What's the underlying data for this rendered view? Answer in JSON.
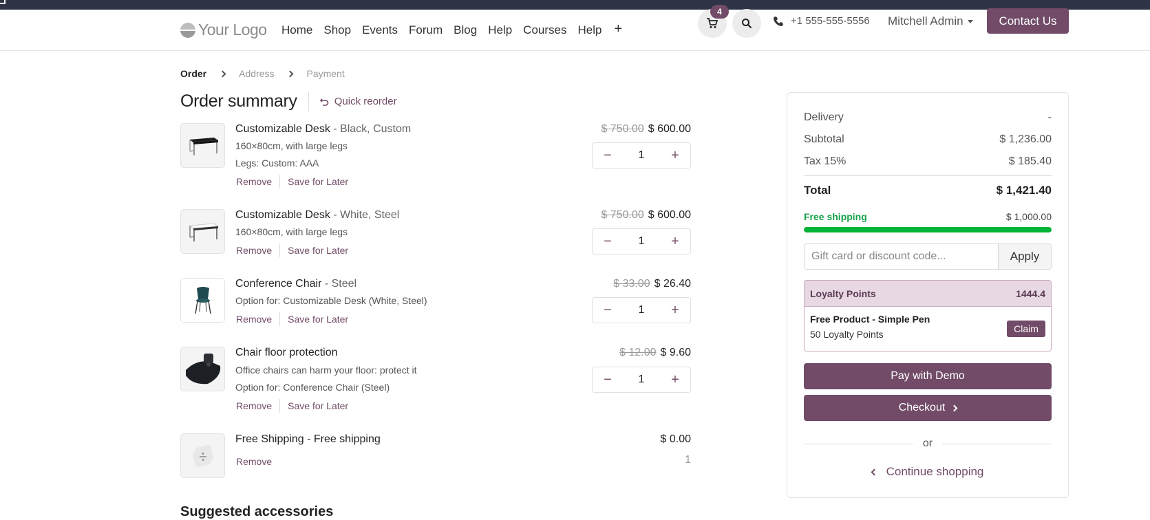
{
  "header": {
    "logo_text": "Your Logo",
    "nav": [
      "Home",
      "Shop",
      "Events",
      "Forum",
      "Blog",
      "Help",
      "Courses",
      "Help"
    ],
    "nav_plus": "+",
    "cart_count": "4",
    "phone": "+1 555-555-5556",
    "user_name": "Mitchell Admin",
    "contact_label": "Contact Us"
  },
  "steps": [
    "Order",
    "Address",
    "Payment"
  ],
  "order": {
    "title": "Order summary",
    "quick_reorder": "Quick reorder",
    "remove_label": "Remove",
    "save_label": "Save for Later",
    "lines": [
      {
        "name": "Customizable Desk",
        "variant": " - Black, Custom",
        "desc": [
          "160×80cm, with large legs",
          "Legs: Custom: AAA"
        ],
        "old_price": "$ 750.00",
        "price": "$ 600.00",
        "qty": "1"
      },
      {
        "name": "Customizable Desk",
        "variant": " - White, Steel",
        "desc": [
          "160×80cm, with large legs"
        ],
        "old_price": "$ 750.00",
        "price": "$ 600.00",
        "qty": "1"
      },
      {
        "name": "Conference Chair",
        "variant": " - Steel",
        "desc": [
          "Option for: Customizable Desk (White, Steel)"
        ],
        "old_price": "$ 33.00",
        "price": "$ 26.40",
        "qty": "1"
      },
      {
        "name": "Chair floor protection",
        "variant": "",
        "desc": [
          "Office chairs can harm your floor: protect it",
          "Option for: Conference Chair (Steel)"
        ],
        "old_price": "$ 12.00",
        "price": "$ 9.60",
        "qty": "1"
      },
      {
        "name": "Free Shipping - Free shipping",
        "variant": "",
        "desc": [],
        "old_price": "",
        "price": "$ 0.00",
        "qty": "1"
      }
    ],
    "suggested_title": "Suggested accessories"
  },
  "summary": {
    "delivery_label": "Delivery",
    "delivery_value": "-",
    "subtotal_label": "Subtotal",
    "subtotal_value": "$ 1,236.00",
    "tax_label": "Tax 15%",
    "tax_value": "$ 185.40",
    "total_label": "Total",
    "total_value": "$ 1,421.40",
    "free_shipping_label": "Free shipping",
    "free_shipping_threshold": "$ 1,000.00",
    "free_shipping_progress": 1.0,
    "discount_placeholder": "Gift card or discount code...",
    "apply_label": "Apply",
    "loyalty_label": "Loyalty Points",
    "loyalty_value": "1444.4",
    "reward_title": "Free Product - Simple Pen",
    "reward_cost": "50 Loyalty Points",
    "claim_label": "Claim",
    "pay_label": "Pay with Demo",
    "checkout_label": "Checkout",
    "or_label": "or",
    "continue_label": "Continue shopping"
  },
  "colors": {
    "brand": "#714b67",
    "success": "#00b336",
    "topbar": "#2f3346"
  }
}
